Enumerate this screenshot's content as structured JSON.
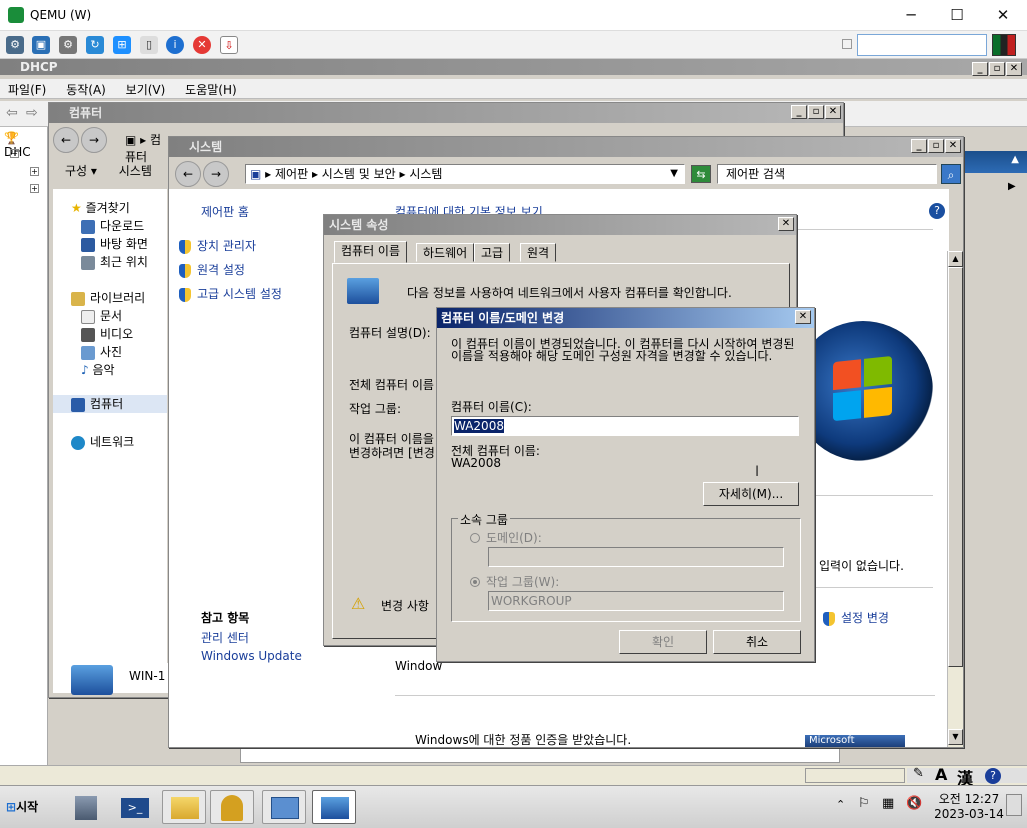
{
  "qemu": {
    "title": "QEMU (W)",
    "minimize": "─",
    "maximize": "☐",
    "close": "✕"
  },
  "dhcp": {
    "title": "DHCP",
    "menu": [
      "파일(F)",
      "동작(A)",
      "보기(V)",
      "도움말(H)"
    ],
    "tree_label": "DHC"
  },
  "computer_window": {
    "title": "컴퓨터",
    "address_fragment": "컴퓨터"
  },
  "system_window": {
    "title": "시스템",
    "breadcrumb": [
      "제어판",
      "시스템 및 보안",
      "시스템"
    ],
    "search_placeholder": "제어판 검색",
    "organize": "구성 ▾",
    "system_tab": "시스템",
    "nav": {
      "favorites": "즐겨찾기",
      "downloads": "다운로드",
      "desktop": "바탕 화면",
      "recent": "최근 위치",
      "libraries": "라이브러리",
      "documents": "문서",
      "videos": "비디오",
      "pictures": "사진",
      "music": "음악",
      "computer": "컴퓨터",
      "network": "네트워크"
    },
    "left_links": {
      "home": "제어판 홈",
      "device_manager": "장치 관리자",
      "remote": "원격 설정",
      "advanced": "고급 시스템 설정"
    },
    "see_also": {
      "heading": "참고 항목",
      "action_center": "관리 센터",
      "windows_update": "Windows Update"
    },
    "right_text": {
      "no_input": "입력이 없습니다.",
      "change_settings": "설정 변경"
    },
    "activation": "Windows에 대한 정품 인증을 받았습니다.",
    "windows_fragment": "Window",
    "bottom_computer": "WIN-1",
    "microsoft_badge": "Microsoft"
  },
  "sysprops": {
    "title": "시스템 속성",
    "tabs": [
      "컴퓨터 이름",
      "하드웨어",
      "고급",
      "원격"
    ],
    "intro": "다음 정보를 사용하여 네트워크에서 사용자 컴퓨터를 확인합니다.",
    "description_label": "컴퓨터 설명(D):",
    "full_name_label": "전체 컴퓨터 이름",
    "workgroup_label": "작업 그룹:",
    "rename_text_1": "이 컴퓨터 이름을",
    "rename_text_2": "변경하려면 [변경",
    "warning": "변경 사항",
    "behind_title": "컴퓨터에 대한 기본 정보 보기"
  },
  "dialog": {
    "title": "컴퓨터 이름/도메인 변경",
    "info": "이 컴퓨터 이름이 변경되었습니다. 이 컴퓨터를 다시 시작하여 변경된 이름을 적용해야 해당 도메인 구성원 자격을 변경할 수 있습니다.",
    "computer_name_label": "컴퓨터 이름(C):",
    "computer_name_value": "WA2008",
    "full_name_label": "전체 컴퓨터 이름:",
    "full_name_value": "WA2008",
    "more_button": "자세히(M)...",
    "member_of": "소속 그룹",
    "domain_label": "도메인(D):",
    "domain_value": "",
    "workgroup_label": "작업 그룹(W):",
    "workgroup_value": "WORKGROUP",
    "ok": "확인",
    "cancel": "취소"
  },
  "taskbar": {
    "start": "시작",
    "ime_a": "A",
    "ime_han": "漢",
    "time": "오전 12:27",
    "date": "2023-03-14"
  }
}
